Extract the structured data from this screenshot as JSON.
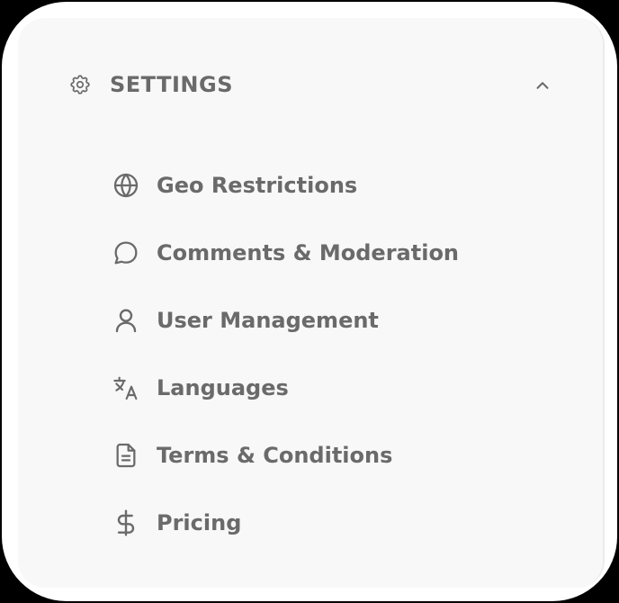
{
  "settings": {
    "title": "SETTINGS",
    "title_icon": "gear-icon",
    "collapse_icon": "chevron-up-icon",
    "items": [
      {
        "label": "Geo Restrictions",
        "icon": "globe-icon"
      },
      {
        "label": "Comments & Moderation",
        "icon": "chat-bubble-icon"
      },
      {
        "label": "User Management",
        "icon": "user-icon"
      },
      {
        "label": "Languages",
        "icon": "translate-icon"
      },
      {
        "label": "Terms & Conditions",
        "icon": "document-icon"
      },
      {
        "label": "Pricing",
        "icon": "dollar-icon"
      }
    ]
  },
  "colors": {
    "text": "#6a6a6a",
    "panel_background": "#f8f8f8",
    "card_background": "#ffffff",
    "outer_background": "#000000"
  }
}
